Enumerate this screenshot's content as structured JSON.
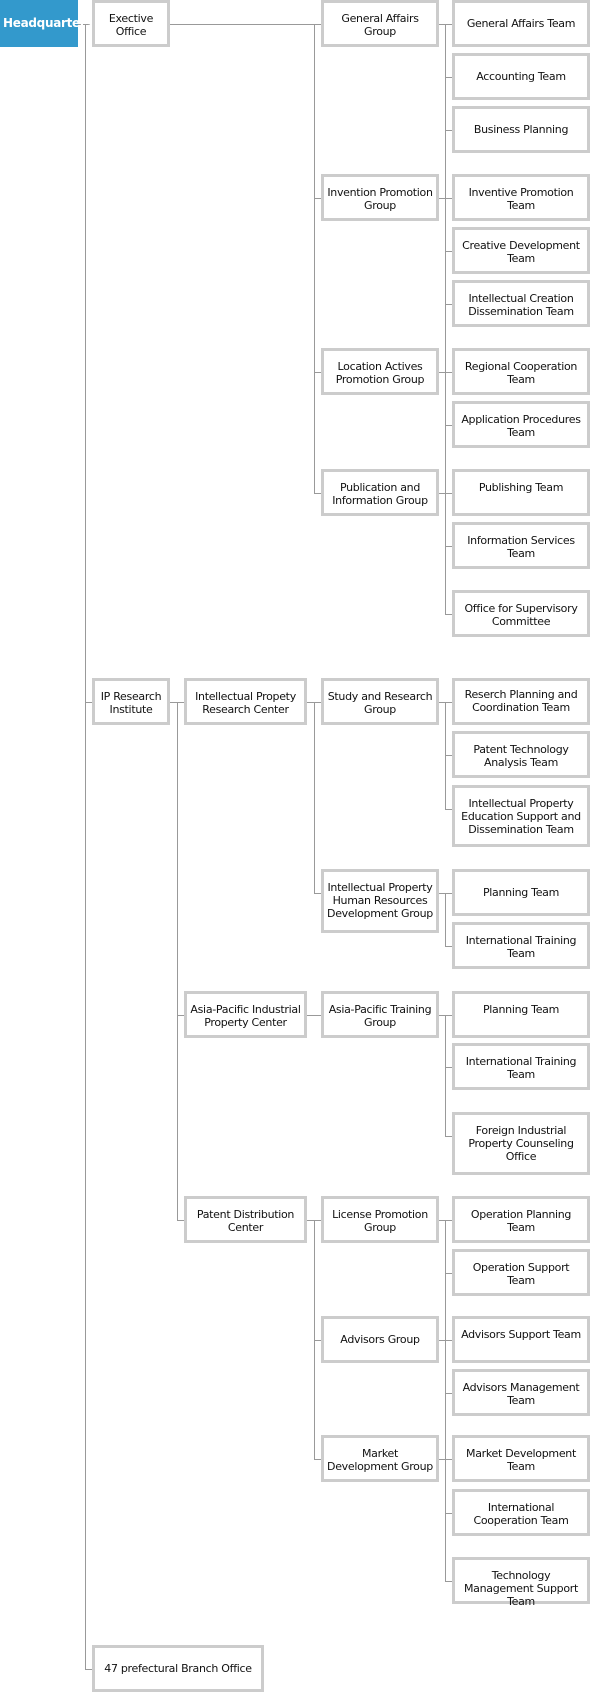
{
  "org": {
    "headquarters": "Headquarters",
    "executive_office": "Exective Office",
    "general_affairs_group": "General Affairs Group",
    "general_affairs_team": "General Affairs Team",
    "accounting_team": "Accounting Team",
    "business_planning": "Business Planning",
    "invention_promotion_group": "Invention Promotion Group",
    "inventive_promotion_team": "Inventive Promotion Team",
    "creative_development_team": "Creative Development Team",
    "intellectual_creation_team": "Intellectual Creation Dissemination Team",
    "location_actives_group": "Location Actives Promotion Group",
    "regional_cooperation_team": "Regional Cooperation Team",
    "application_procedures_team": "Application Procedures Team",
    "publication_group": "Publication and Information Group",
    "publishing_team": "Publishing Team",
    "information_services_team": "Information Services Team",
    "supervisory_office": "Office for Supervisory Committee",
    "ip_research_institute": "IP Research Institute",
    "ip_research_center": "Intellectual Propety Research Center",
    "study_research_group": "Study and Research Group",
    "research_planning_team": "Reserch Planning and Coordination Team",
    "patent_technology_team": "Patent Technology Analysis Team",
    "ip_education_team": "Intellectual Property Education Support and Dissemination Team",
    "ip_hr_group": "Intellectual Property Human Resources Development Group",
    "planning_team_1": "Planning Team",
    "international_training_team_1": "International Training Team",
    "asia_pacific_center": "Asia-Pacific Industrial Property Center",
    "asia_pacific_training_group": "Asia-Pacific Training Group",
    "planning_team_2": "Planning Team",
    "international_training_team_2": "International Training Team",
    "foreign_counseling_office": "Foreign Industrial Property Counseling Office",
    "patent_distribution_center": "Patent Distribution Center",
    "license_promotion_group": "License Promotion Group",
    "operation_planning_team": "Operation Planning Team",
    "operation_support_team": "Operation Support Team",
    "advisors_group": "Advisors Group",
    "advisors_support_team": "Advisors Support Team",
    "advisors_management_team": "Advisors Management Team",
    "market_development_group": "Market Development Group",
    "market_development_team": "Market Development Team",
    "international_cooperation_team": "International Cooperation Team",
    "technology_management_team": "Technology Management Support Team",
    "branch_offices": "47 prefectural Branch Office"
  },
  "colors": {
    "headquarters": "#3399cc",
    "box_border": "#cccccc",
    "connector": "#999999"
  }
}
